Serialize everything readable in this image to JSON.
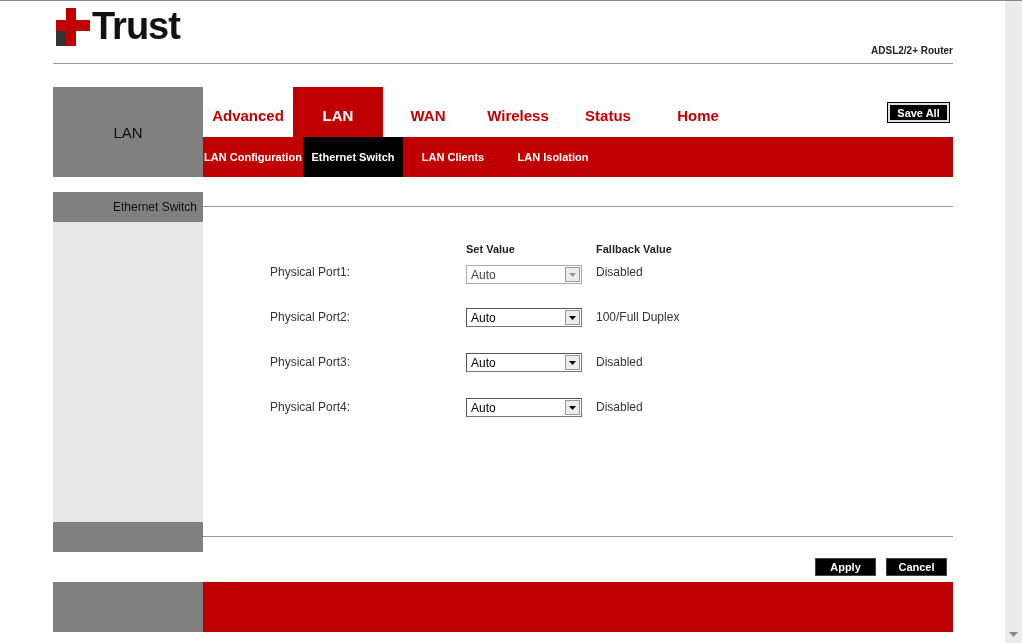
{
  "header": {
    "logo_text": "Trust",
    "product": "ADSL2/2+ Router",
    "save_button": "Save All"
  },
  "section_label": "LAN",
  "tabs": [
    {
      "label": "Advanced",
      "selected": false
    },
    {
      "label": "LAN",
      "selected": true
    },
    {
      "label": "WAN",
      "selected": false
    },
    {
      "label": "Wireless",
      "selected": false
    },
    {
      "label": "Status",
      "selected": false
    },
    {
      "label": "Home",
      "selected": false
    }
  ],
  "subtabs": [
    {
      "label": "LAN Configuration",
      "selected": false
    },
    {
      "label": "Ethernet Switch",
      "selected": true
    },
    {
      "label": "LAN Clients",
      "selected": false
    },
    {
      "label": "LAN Isolation",
      "selected": false
    }
  ],
  "panel": {
    "title": "Ethernet Switch",
    "columns": [
      "Set Value",
      "Fallback Value"
    ],
    "ports": [
      {
        "label": "Physical Port1:",
        "value": "Auto",
        "disabled": true,
        "fallback": "Disabled"
      },
      {
        "label": "Physical Port2:",
        "value": "Auto",
        "disabled": false,
        "fallback": "100/Full Duplex"
      },
      {
        "label": "Physical Port3:",
        "value": "Auto",
        "disabled": false,
        "fallback": "Disabled"
      },
      {
        "label": "Physical Port4:",
        "value": "Auto",
        "disabled": false,
        "fallback": "Disabled"
      }
    ]
  },
  "buttons": [
    "Apply",
    "Cancel"
  ]
}
